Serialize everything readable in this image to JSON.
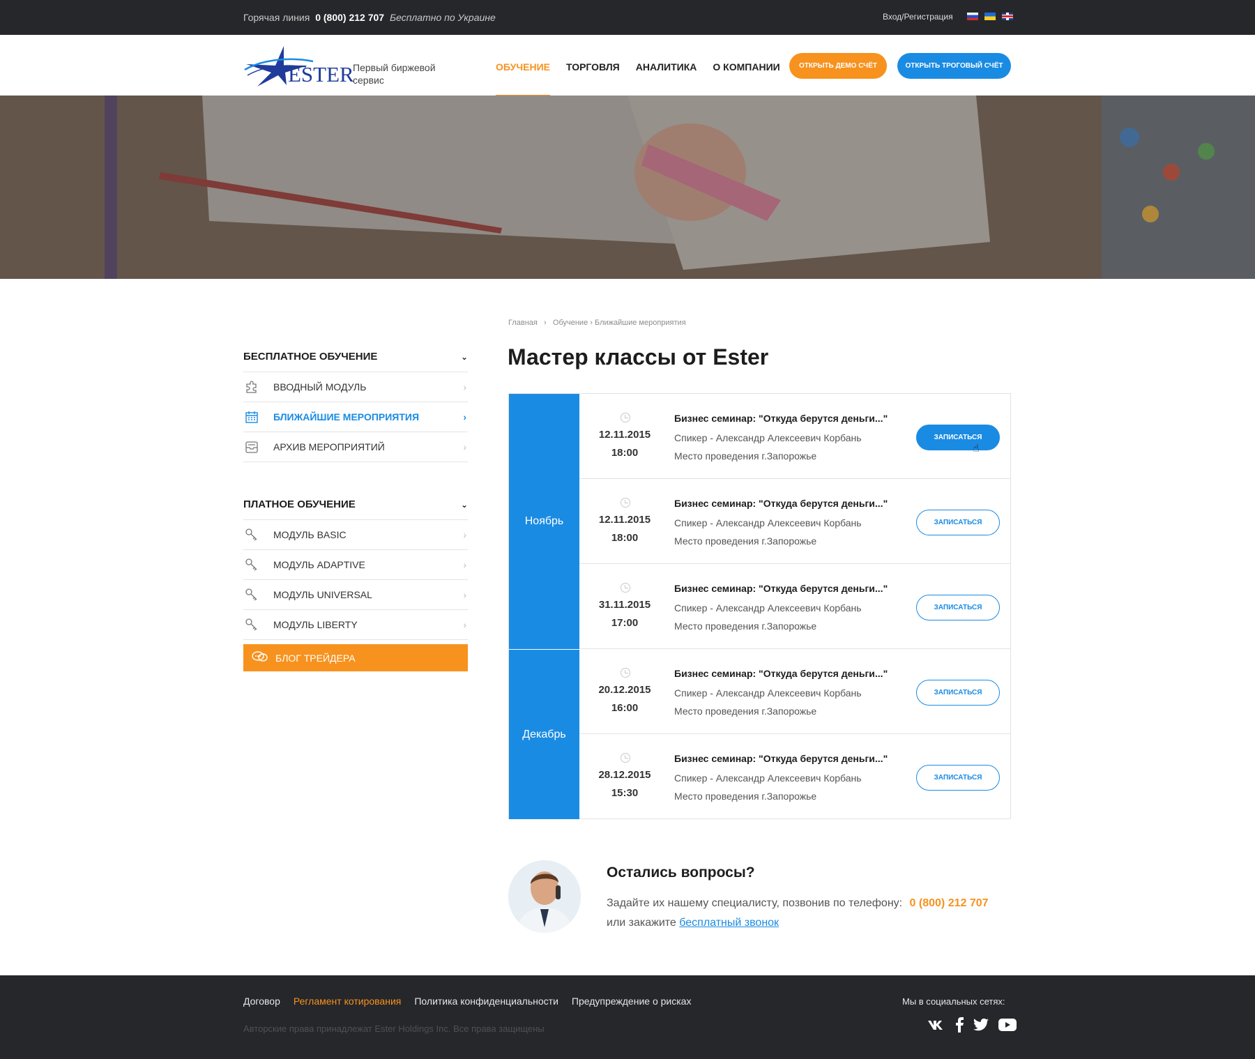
{
  "topbar": {
    "hotline_label": "Горячая линия",
    "hotline_phone": "0 (800) 212 707",
    "hotline_note": "Бесплатно по Украине",
    "login": "Вход/Регистрация",
    "flags": [
      "flag-ru-icon",
      "flag-ua-icon",
      "flag-en-icon"
    ]
  },
  "header": {
    "logo_text": "ESTER",
    "tagline": "Первый биржевой сервис",
    "nav": [
      {
        "label": "ОБУЧЕНИЕ",
        "active": true
      },
      {
        "label": "ТОРГОВЛЯ"
      },
      {
        "label": "АНАЛИТИКА"
      },
      {
        "label": "О КОМПАНИИ"
      }
    ],
    "btn_demo": "Открыть демо счёт",
    "btn_trade": "Открыть троговый счёт"
  },
  "sidebar": {
    "free_title": "БЕСПЛАТНОЕ ОБУЧЕНИЕ",
    "free_items": [
      {
        "label": "Вводный модуль",
        "icon": "puzzle-icon"
      },
      {
        "label": "Ближайшие мероприятия",
        "icon": "calendar-icon",
        "active": true
      },
      {
        "label": "Архив мероприятий",
        "icon": "archive-icon"
      }
    ],
    "paid_title": "ПЛАТНОЕ ОБУЧЕНИЕ",
    "paid_items": [
      {
        "label": "Модуль BASIC",
        "icon": "key-icon"
      },
      {
        "label": "Модуль ADAPTIVE",
        "icon": "key-icon"
      },
      {
        "label": "Модуль UNIVERSAL",
        "icon": "key-icon"
      },
      {
        "label": "Модуль LIBERTY",
        "icon": "key-icon"
      }
    ],
    "blog": "Блог трейдера"
  },
  "breadcrumb": [
    "Главная",
    "Обучение",
    "Ближайшие мероприятия"
  ],
  "page_title": "Мастер классы от Ester",
  "months": [
    "Ноябрь",
    "Декабрь"
  ],
  "events": [
    {
      "date": "12.11.2015",
      "time": "18:00",
      "title": "Бизнес семинар: \"Откуда берутся деньги...\"",
      "speaker": "Спикер - Александр Алексеевич Корбань",
      "place": "Место проведения  г.Запорожье",
      "button": "Записаться"
    },
    {
      "date": "12.11.2015",
      "time": "18:00",
      "title": "Бизнес семинар: \"Откуда берутся деньги...\"",
      "speaker": "Спикер - Александр Алексеевич Корбань",
      "place": "Место проведения  г.Запорожье",
      "button": "Записаться"
    },
    {
      "date": "31.11.2015",
      "time": "17:00",
      "title": "Бизнес семинар: \"Откуда берутся деньги...\"",
      "speaker": "Спикер - Александр Алексеевич Корбань",
      "place": "Место проведения  г.Запорожье",
      "button": "Записаться"
    },
    {
      "date": "20.12.2015",
      "time": "16:00",
      "title": "Бизнес семинар: \"Откуда берутся деньги...\"",
      "speaker": "Спикер - Александр Алексеевич Корбань",
      "place": "Место проведения  г.Запорожье",
      "button": "Записаться"
    },
    {
      "date": "28.12.2015",
      "time": "15:30",
      "title": "Бизнес семинар: \"Откуда берутся деньги...\"",
      "speaker": "Спикер - Александр Алексеевич Корбань",
      "place": "Место проведения  г.Запорожье",
      "button": "Записаться"
    }
  ],
  "questions": {
    "title": "Остались вопросы?",
    "text": "Задайте их нашему специалисту, позвонив по телефону:",
    "phone": "0 (800) 212 707",
    "or_text": "или закажите",
    "link": "бесплатный звонок"
  },
  "footer": {
    "links": [
      "Договор",
      "Регламент котирования",
      "Политика конфиденциальности",
      "Предупреждение о рисках"
    ],
    "copyright": "Авторские права принадлежат  Ester Holdings Inc. Все права защищены",
    "social_label": "Мы в социальных сетях:",
    "social": [
      "vk-icon",
      "facebook-icon",
      "twitter-icon",
      "youtube-icon"
    ]
  },
  "colors": {
    "accent": "#1a8be3",
    "orange": "#f7921e",
    "dark": "#26272b"
  }
}
